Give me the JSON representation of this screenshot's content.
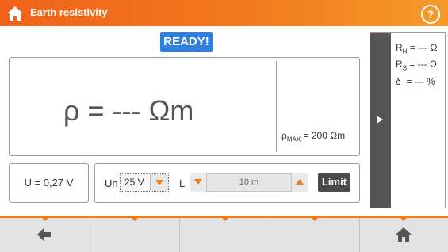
{
  "header": {
    "title": "Earth resistivity",
    "home_icon": "home-icon",
    "help_icon": "help-icon",
    "help_symbol": "?"
  },
  "status": {
    "ready_label": "READY!"
  },
  "result": {
    "rho_main": "ρ = --- Ωm",
    "rho_max_prefix": "ρ",
    "rho_max_sub": "MAX",
    "rho_max_value": " = 200 Ωm"
  },
  "side_panel": {
    "expand_icon": "play-arrow-icon",
    "rh_label": "R",
    "rh_sub": "H",
    "rh_value": " = --- Ω",
    "rs_label": "R",
    "rs_sub": "S",
    "rs_value": " = --- Ω",
    "delta_line": "δ  = --- %"
  },
  "voltage": {
    "u_text": "U = 0,27 V"
  },
  "controls": {
    "un_label": "Un",
    "un_value": "25 V",
    "l_label": "L",
    "l_value": "10 m",
    "limit_label": "Limit"
  },
  "bottom_nav": {
    "back_icon": "back-arrow-icon",
    "home_icon": "home-icon"
  },
  "colors": {
    "accent": "#f07b1c",
    "ready_bg": "#2f7fe0",
    "dark_panel": "#555555"
  }
}
